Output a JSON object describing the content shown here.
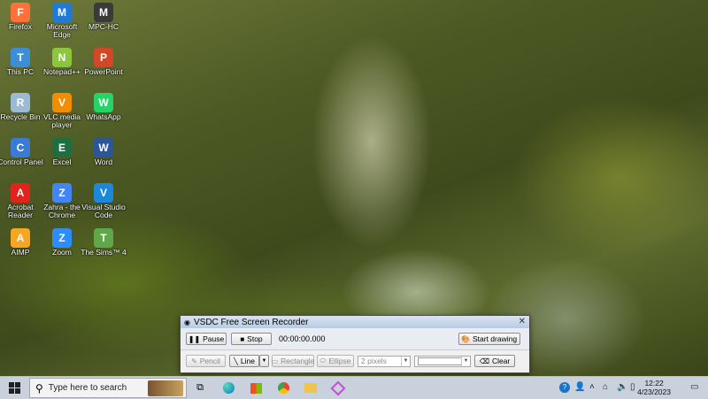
{
  "desktop": {
    "icons": [
      {
        "label": "Firefox",
        "icon": "firefox-icon",
        "color": "#ff7139"
      },
      {
        "label": "Microsoft Edge",
        "icon": "edge-icon",
        "color": "#1f7bd6"
      },
      {
        "label": "MPC-HC",
        "icon": "mpc-hc-icon",
        "color": "#3a3a3a"
      },
      {
        "label": "This PC",
        "icon": "this-pc-icon",
        "color": "#3b8fd6"
      },
      {
        "label": "Notepad++",
        "icon": "notepad-plus-plus-icon",
        "color": "#8cc63f"
      },
      {
        "label": "PowerPoint",
        "icon": "powerpoint-icon",
        "color": "#d24726"
      },
      {
        "label": "Recycle Bin",
        "icon": "recycle-bin-icon",
        "color": "#9bbad6"
      },
      {
        "label": "VLC media player",
        "icon": "vlc-icon",
        "color": "#f28c00"
      },
      {
        "label": "WhatsApp",
        "icon": "whatsapp-icon",
        "color": "#25d366"
      },
      {
        "label": "Control Panel",
        "icon": "control-panel-icon",
        "color": "#3a7bd5"
      },
      {
        "label": "Excel",
        "icon": "excel-icon",
        "color": "#1d6f42"
      },
      {
        "label": "Word",
        "icon": "word-icon",
        "color": "#2b579a"
      },
      {
        "label": "Acrobat Reader",
        "icon": "acrobat-reader-icon",
        "color": "#e0231c"
      },
      {
        "label": "Zahra - the Chrome",
        "icon": "chrome-icon",
        "color": "#4285f4"
      },
      {
        "label": "Visual Studio Code",
        "icon": "vscode-icon",
        "color": "#1e88d8"
      },
      {
        "label": "AIMP",
        "icon": "aimp-icon",
        "color": "#f5a623"
      },
      {
        "label": "Zoom",
        "icon": "zoom-icon",
        "color": "#2d8cff"
      },
      {
        "label": "The Sims™ 4",
        "icon": "sims-icon",
        "color": "#5fa84a"
      }
    ]
  },
  "recorder": {
    "title": "VSDC Free Screen Recorder",
    "pause_label": "Pause",
    "stop_label": "Stop",
    "timer": "00:00:00.000",
    "start_drawing_label": "Start drawing",
    "pencil_label": "Pencil",
    "line_label": "Line",
    "rectangle_label": "Rectangle",
    "ellipse_label": "Ellipse",
    "thickness_value": "2 pixels",
    "clear_label": "Clear"
  },
  "taskbar": {
    "search_placeholder": "Type here to search",
    "time": "12:22",
    "date": "4/23/2023",
    "pinned": [
      "task-view-icon",
      "edge-icon",
      "microsoft-store-icon",
      "chrome-icon",
      "file-explorer-icon",
      "app-icon"
    ]
  }
}
